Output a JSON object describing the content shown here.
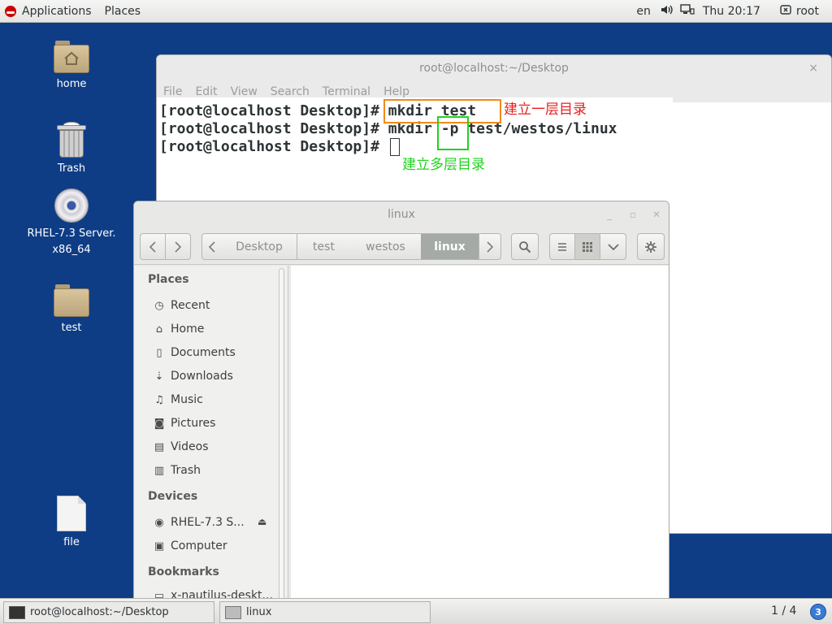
{
  "topbar": {
    "applications": "Applications",
    "places": "Places",
    "lang": "en",
    "clock": "Thu 20:17",
    "user": "root"
  },
  "desktop": {
    "icons": [
      {
        "label": "home"
      },
      {
        "label": "Trash"
      },
      {
        "label": "RHEL-7.3 Server.\nx86_64"
      },
      {
        "label": "test"
      },
      {
        "label": "file"
      }
    ]
  },
  "terminal": {
    "title": "root@localhost:~/Desktop",
    "close_glyph": "×",
    "menu": [
      "File",
      "Edit",
      "View",
      "Search",
      "Terminal",
      "Help"
    ],
    "lines": [
      "[root@localhost Desktop]# mkdir test",
      "[root@localhost Desktop]# mkdir -p test/westos/linux",
      "[root@localhost Desktop]# "
    ],
    "annotation_orange_text": "建立一层目录",
    "annotation_green_text": "建立多层目录",
    "colors": {
      "orange": "#f08a1b",
      "green": "#1fd41f",
      "red": "#e82020"
    }
  },
  "file_manager": {
    "title": "linux",
    "breadcrumbs": [
      "Desktop",
      "test",
      "westos",
      "linux"
    ],
    "active_crumb": "linux",
    "sidebar": {
      "places_header": "Places",
      "places": [
        {
          "icon": "clock-icon",
          "label": "Recent"
        },
        {
          "icon": "home-icon",
          "label": "Home"
        },
        {
          "icon": "document-icon",
          "label": "Documents"
        },
        {
          "icon": "download-icon",
          "label": "Downloads"
        },
        {
          "icon": "music-icon",
          "label": "Music"
        },
        {
          "icon": "camera-icon",
          "label": "Pictures"
        },
        {
          "icon": "film-icon",
          "label": "Videos"
        },
        {
          "icon": "trash-icon",
          "label": "Trash"
        }
      ],
      "devices_header": "Devices",
      "devices": [
        {
          "icon": "disc-icon",
          "label": "RHEL-7.3 S..."
        },
        {
          "icon": "computer-icon",
          "label": "Computer"
        }
      ],
      "bookmarks_header": "Bookmarks",
      "bookmarks": [
        {
          "icon": "folder-icon",
          "label": "x-nautilus-deskt..."
        }
      ]
    }
  },
  "taskbar": {
    "tasks": [
      {
        "label": "root@localhost:~/Desktop"
      },
      {
        "label": "linux"
      }
    ],
    "workspace": "1 / 4",
    "badge": "3"
  }
}
